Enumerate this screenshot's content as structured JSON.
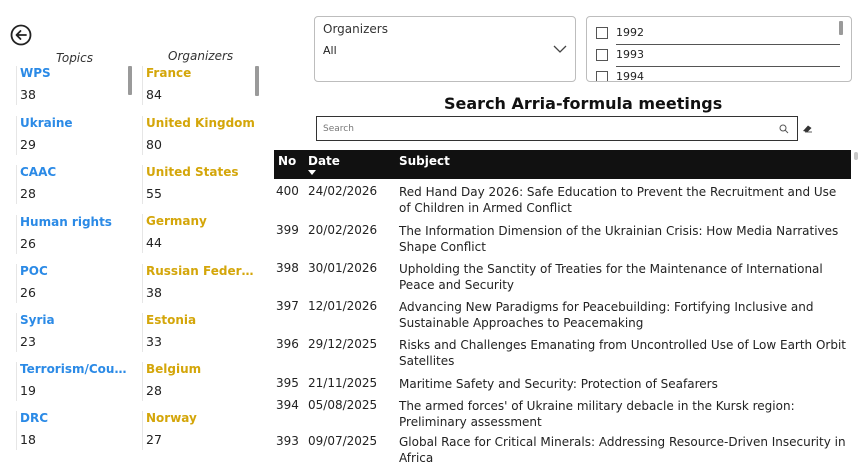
{
  "nav": {
    "back_icon": "arrow-left-circle-icon"
  },
  "topics_panel": {
    "header": "Topics",
    "items": [
      {
        "label": "WPS",
        "count": "38"
      },
      {
        "label": "Ukraine",
        "count": "29"
      },
      {
        "label": "CAAC",
        "count": "28"
      },
      {
        "label": "Human rights",
        "count": "26"
      },
      {
        "label": "POC",
        "count": "26"
      },
      {
        "label": "Syria",
        "count": "23"
      },
      {
        "label": "Terrorism/Count...",
        "count": "19"
      },
      {
        "label": "DRC",
        "count": "18"
      }
    ],
    "color": "#2b8ae6"
  },
  "organizers_panel": {
    "header": "Organizers",
    "items": [
      {
        "label": "France",
        "count": "84"
      },
      {
        "label": "United Kingdom",
        "count": "80"
      },
      {
        "label": "United States",
        "count": "55"
      },
      {
        "label": "Germany",
        "count": "44"
      },
      {
        "label": "Russian Federati...",
        "count": "38"
      },
      {
        "label": "Estonia",
        "count": "33"
      },
      {
        "label": "Belgium",
        "count": "28"
      },
      {
        "label": "Norway",
        "count": "27"
      }
    ],
    "color": "#d4a60a"
  },
  "organizers_filter": {
    "title": "Organizers",
    "selected": "All"
  },
  "year_filter": {
    "years": [
      "1992",
      "1993",
      "1994"
    ]
  },
  "search": {
    "title": "Search Arria-formula meetings",
    "placeholder": "Search"
  },
  "table": {
    "columns": [
      "No",
      "Date",
      "Subject"
    ],
    "rows": [
      {
        "no": "400",
        "date": "24/02/2026",
        "subject": "Red Hand Day 2026: Safe Education to Prevent the Recruitment and Use of Children in Armed Conflict"
      },
      {
        "no": "399",
        "date": "20/02/2026",
        "subject": "The Information Dimension of the Ukrainian Crisis: How Media Narratives Shape Conflict"
      },
      {
        "no": "398",
        "date": "30/01/2026",
        "subject": "Upholding the Sanctity of Treaties for the Maintenance of International Peace and Security"
      },
      {
        "no": "397",
        "date": "12/01/2026",
        "subject": "Advancing New Paradigms for Peacebuilding: Fortifying Inclusive and Sustainable Approaches to Peacemaking"
      },
      {
        "no": "396",
        "date": "29/12/2025",
        "subject": "Risks and Challenges Emanating from Uncontrolled Use of Low Earth Orbit Satellites"
      },
      {
        "no": "395",
        "date": "21/11/2025",
        "subject": "Maritime Safety and Security: Protection of Seafarers"
      },
      {
        "no": "394",
        "date": "05/08/2025",
        "subject": "The armed forces' of Ukraine military debacle in the Kursk region: Preliminary assessment"
      },
      {
        "no": "393",
        "date": "09/07/2025",
        "subject": "Global Race for Critical Minerals: Addressing Resource-Driven Insecurity in Africa"
      }
    ]
  }
}
